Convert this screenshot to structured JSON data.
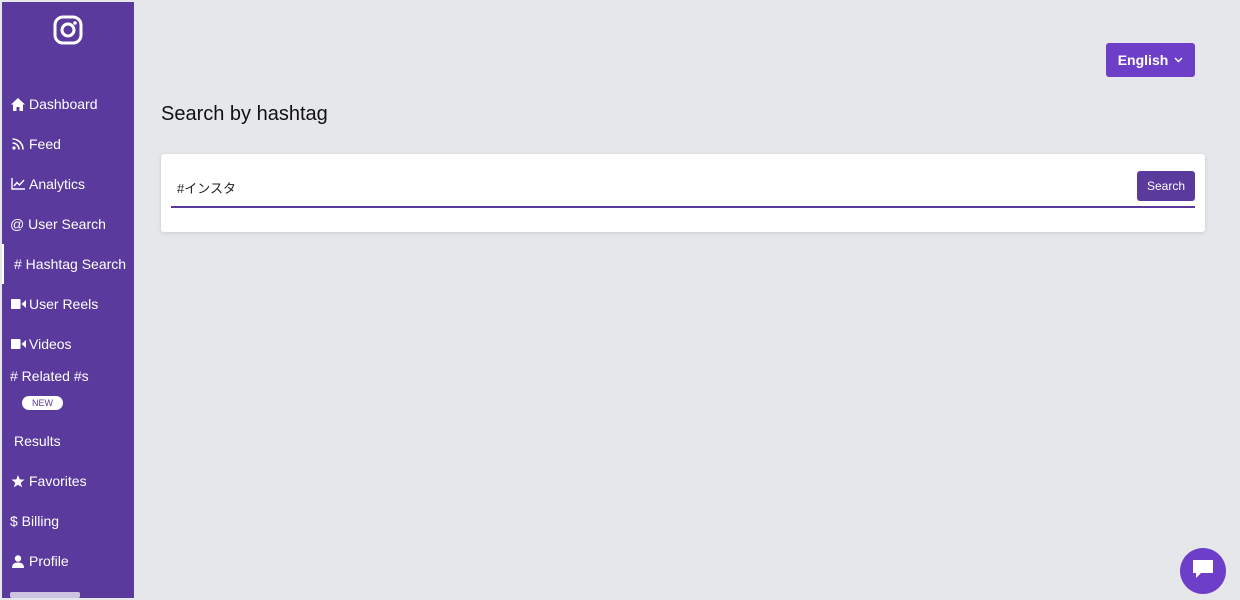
{
  "sidebar": {
    "items": [
      {
        "label": "Dashboard",
        "icon": "home-icon"
      },
      {
        "label": "Feed",
        "icon": "rss-icon"
      },
      {
        "label": "Analytics",
        "icon": "chart-line-icon"
      },
      {
        "label": "@ User Search",
        "icon": "at-icon"
      },
      {
        "label": "# Hashtag Search",
        "icon": "hashtag-icon",
        "active": true
      },
      {
        "label": "User Reels",
        "icon": "video-icon"
      },
      {
        "label": "Videos",
        "icon": "video-icon"
      },
      {
        "label": "# Related #s",
        "icon": "hashtag-icon"
      },
      {
        "label": "Results",
        "icon": ""
      },
      {
        "label": "Favorites",
        "icon": "star-icon"
      },
      {
        "label": "$ Billing",
        "icon": "dollar-icon"
      },
      {
        "label": "Profile",
        "icon": "user-icon"
      }
    ],
    "new_badge": "NEW"
  },
  "header": {
    "language": "English"
  },
  "main": {
    "title": "Search by hashtag",
    "search": {
      "value": "#インスタ",
      "button_label": "Search"
    }
  },
  "colors": {
    "sidebar_bg": "#5b3a9e",
    "accent": "#6d3fc8",
    "page_bg": "#e5e7eb"
  }
}
